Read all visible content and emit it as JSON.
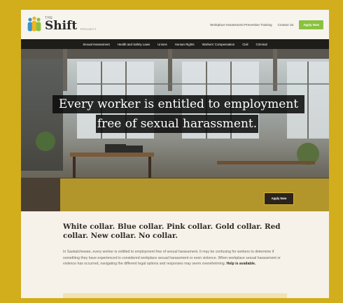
{
  "brand": {
    "the": "THE",
    "name": "Shift",
    "suffix": "PROJECT"
  },
  "topnav": {
    "training": "Workplace Harassment Prevention Training",
    "contact": "Contact Us",
    "apply": "Apply Now"
  },
  "mainnav": [
    "Sexual Harassment",
    "Health and Safety Laws",
    "Unions",
    "Human Rights",
    "Workers' Compensation",
    "Civil",
    "Criminal"
  ],
  "hero": {
    "line1": "Every worker is entitled to employment",
    "line2": "free of sexual harassment.",
    "button": "Apply Now"
  },
  "content": {
    "heading": "White collar. Blue collar. Pink collar. Gold collar. Red collar. New collar. No collar.",
    "paragraph": "In Saskatchewan, every worker is entitled to employment free of sexual harassment. It may be confusing for workers to determine if something they have experienced is considered workplace sexual harassment or even violence. When workplace sexual harassment or violence has occurred, navigating the different legal options and responses may seem overwhelming.",
    "paragraph_bold": "Help is available."
  },
  "colors": {
    "frame": "#d2ad1c",
    "accent_green": "#8ac23f",
    "nav_bg": "#1f1d1a",
    "overlay_yellow": "#d6b42a"
  }
}
